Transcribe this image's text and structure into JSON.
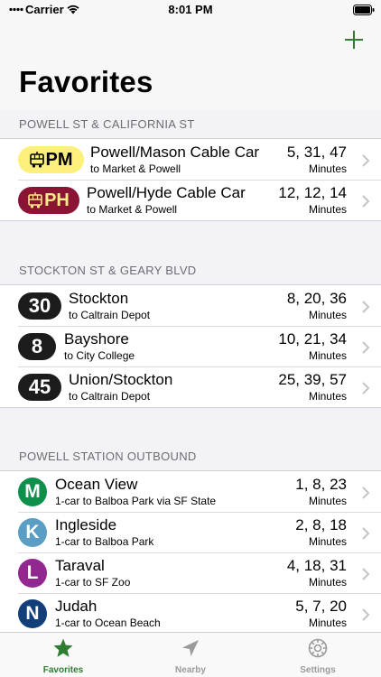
{
  "status": {
    "carrier": "Carrier",
    "time": "8:01 PM"
  },
  "nav": {
    "title": "Favorites"
  },
  "sections": [
    {
      "header": "POWELL ST & CALIFORNIA ST"
    },
    {
      "header": "STOCKTON ST & GEARY BLVD"
    },
    {
      "header": "POWELL STATION OUTBOUND"
    }
  ],
  "rows": [
    {
      "badge": "PM",
      "name": "Powell/Mason Cable Car",
      "dest": "to Market & Powell",
      "times": "5, 31, 47",
      "unit": "Minutes"
    },
    {
      "badge": "PH",
      "name": "Powell/Hyde Cable Car",
      "dest": "to Market & Powell",
      "times": "12, 12, 14",
      "unit": "Minutes"
    },
    {
      "badge": "30",
      "name": "Stockton",
      "dest": "to Caltrain Depot",
      "times": "8, 20, 36",
      "unit": "Minutes"
    },
    {
      "badge": "8",
      "name": "Bayshore",
      "dest": "to City College",
      "times": "10, 21, 34",
      "unit": "Minutes"
    },
    {
      "badge": "45",
      "name": "Union/Stockton",
      "dest": "to Caltrain Depot",
      "times": "25, 39, 57",
      "unit": "Minutes"
    },
    {
      "badge": "M",
      "name": "Ocean View",
      "dest": "1-car to Balboa Park via SF State",
      "times": "1, 8, 23",
      "unit": "Minutes"
    },
    {
      "badge": "K",
      "name": "Ingleside",
      "dest": "1-car to Balboa Park",
      "times": "2, 8, 18",
      "unit": "Minutes"
    },
    {
      "badge": "L",
      "name": "Taraval",
      "dest": "1-car to SF Zoo",
      "times": "4, 18, 31",
      "unit": "Minutes"
    },
    {
      "badge": "N",
      "name": "Judah",
      "dest": "1-car to Ocean Beach",
      "times": "5, 7, 20",
      "unit": "Minutes"
    }
  ],
  "tabs": [
    {
      "label": "Favorites",
      "icon": "star-icon"
    },
    {
      "label": "Nearby",
      "icon": "location-arrow-icon"
    },
    {
      "label": "Settings",
      "icon": "gear-icon"
    }
  ],
  "colors": {
    "accent": "#2e7d32",
    "pm_badge": "#fdf07a",
    "ph_badge": "#8b1434",
    "bus_badge": "#1c1c1c",
    "line_m": "#0e8f4a",
    "line_k": "#5a9ec4",
    "line_l": "#92278f",
    "line_n": "#123f7a"
  }
}
